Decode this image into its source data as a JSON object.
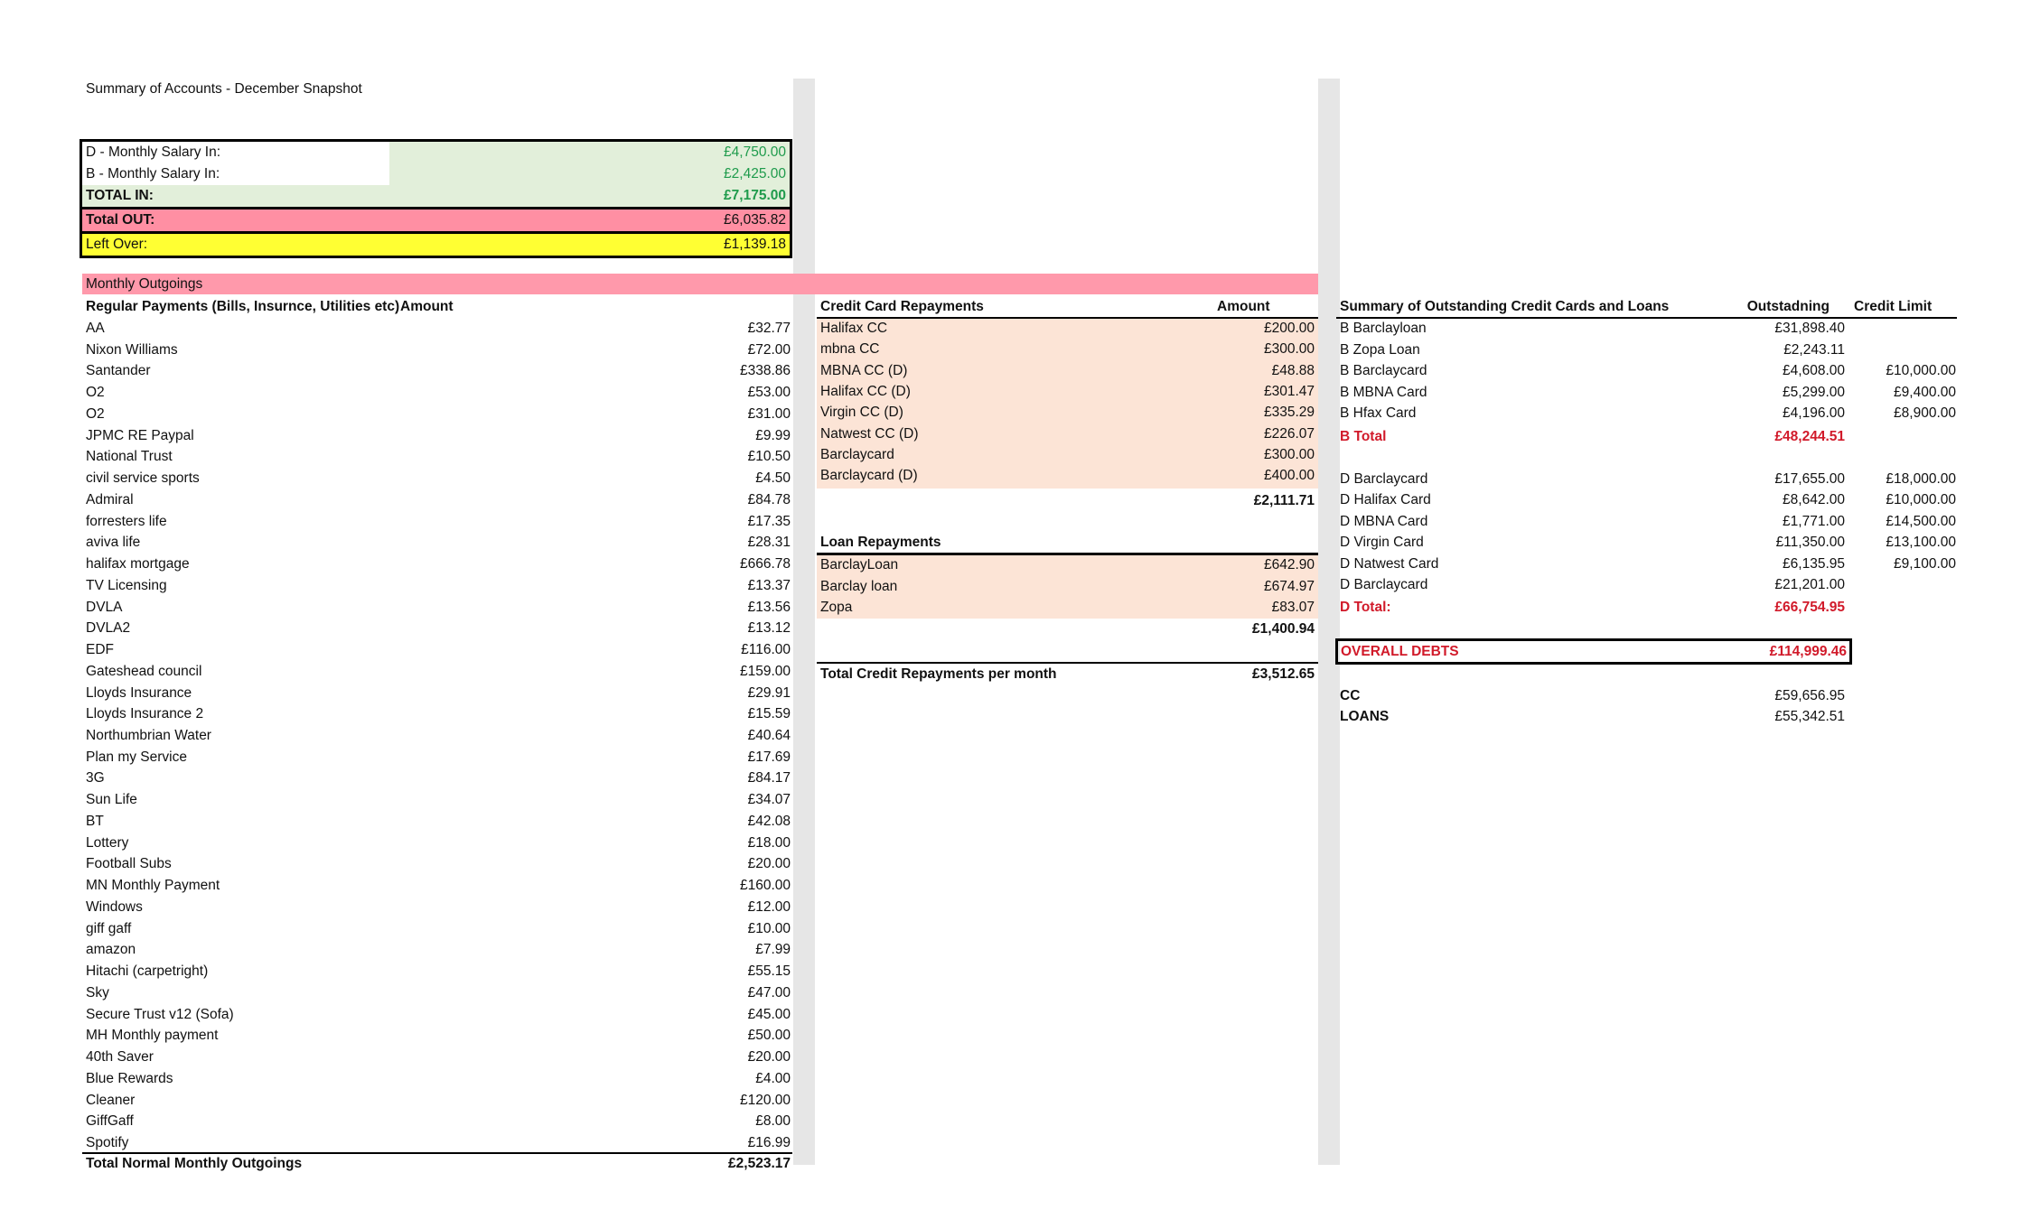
{
  "title": "Summary of Accounts - December Snapshot",
  "income": {
    "d_salary_label": "D - Monthly Salary In:",
    "d_salary_value": "£4,750.00",
    "b_salary_label": "B - Monthly Salary In:",
    "b_salary_value": "£2,425.00",
    "total_in_label": "TOTAL IN:",
    "total_in_value": "£7,175.00",
    "total_out_label": "Total OUT:",
    "total_out_value": "£6,035.82",
    "left_over_label": "Left Over:",
    "left_over_value": "£1,139.18"
  },
  "section_title": "Monthly Outgoings",
  "regular": {
    "header_label": "Regular Payments (Bills, Insurnce, Utilities etc)",
    "header_amount": "Amount",
    "rows": [
      {
        "name": "AA",
        "amount": "£32.77"
      },
      {
        "name": "Nixon Williams",
        "amount": "£72.00"
      },
      {
        "name": "Santander",
        "amount": "£338.86"
      },
      {
        "name": "O2",
        "amount": "£53.00"
      },
      {
        "name": "O2",
        "amount": "£31.00"
      },
      {
        "name": "JPMC RE Paypal",
        "amount": "£9.99"
      },
      {
        "name": "National Trust",
        "amount": "£10.50"
      },
      {
        "name": "civil service sports",
        "amount": "£4.50"
      },
      {
        "name": "Admiral",
        "amount": "£84.78"
      },
      {
        "name": "forresters life",
        "amount": "£17.35"
      },
      {
        "name": "aviva life",
        "amount": "£28.31"
      },
      {
        "name": "halifax mortgage",
        "amount": "£666.78"
      },
      {
        "name": "TV Licensing",
        "amount": "£13.37"
      },
      {
        "name": "DVLA",
        "amount": "£13.56"
      },
      {
        "name": "DVLA2",
        "amount": "£13.12"
      },
      {
        "name": "EDF",
        "amount": "£116.00"
      },
      {
        "name": "Gateshead council",
        "amount": "£159.00"
      },
      {
        "name": "Lloyds Insurance",
        "amount": "£29.91"
      },
      {
        "name": "Lloyds Insurance 2",
        "amount": "£15.59"
      },
      {
        "name": "Northumbrian Water",
        "amount": "£40.64"
      },
      {
        "name": "Plan my Service",
        "amount": "£17.69"
      },
      {
        "name": "3G",
        "amount": "£84.17"
      },
      {
        "name": "Sun Life",
        "amount": "£34.07"
      },
      {
        "name": "BT",
        "amount": "£42.08"
      },
      {
        "name": "Lottery",
        "amount": "£18.00"
      },
      {
        "name": "Football Subs",
        "amount": "£20.00"
      },
      {
        "name": "MN Monthly Payment",
        "amount": "£160.00"
      },
      {
        "name": "Windows",
        "amount": "£12.00"
      },
      {
        "name": "giff gaff",
        "amount": "£10.00"
      },
      {
        "name": "amazon",
        "amount": "£7.99"
      },
      {
        "name": "Hitachi (carpetright)",
        "amount": "£55.15"
      },
      {
        "name": "Sky",
        "amount": "£47.00"
      },
      {
        "name": "Secure Trust v12 (Sofa)",
        "amount": "£45.00"
      },
      {
        "name": "MH Monthly payment",
        "amount": "£50.00"
      },
      {
        "name": "40th Saver",
        "amount": "£20.00"
      },
      {
        "name": "Blue Rewards",
        "amount": "£4.00"
      },
      {
        "name": "Cleaner",
        "amount": "£120.00"
      },
      {
        "name": "GiffGaff",
        "amount": "£8.00"
      },
      {
        "name": "Spotify",
        "amount": "£16.99"
      }
    ],
    "total_label": "Total Normal Monthly Outgoings",
    "total_value": "£2,523.17"
  },
  "credit_cards": {
    "header_label": "Credit Card Repayments",
    "header_amount": "Amount",
    "rows": [
      {
        "name": "Halifax CC",
        "amount": "£200.00"
      },
      {
        "name": "mbna CC",
        "amount": "£300.00"
      },
      {
        "name": "MBNA CC (D)",
        "amount": "£48.88"
      },
      {
        "name": "Halifax CC (D)",
        "amount": "£301.47"
      },
      {
        "name": "Virgin CC (D)",
        "amount": "£335.29"
      },
      {
        "name": "Natwest CC (D)",
        "amount": "£226.07"
      },
      {
        "name": "Barclaycard",
        "amount": "£300.00"
      },
      {
        "name": "Barclaycard (D)",
        "amount": "£400.00"
      }
    ],
    "subtotal": "£2,111.71"
  },
  "loans": {
    "header_label": "Loan Repayments",
    "rows": [
      {
        "name": "BarclayLoan",
        "amount": "£642.90"
      },
      {
        "name": "Barclay loan",
        "amount": "£674.97"
      },
      {
        "name": "Zopa",
        "amount": "£83.07"
      }
    ],
    "subtotal": "£1,400.94",
    "total_label": "Total Credit Repayments per month",
    "total_value": "£3,512.65"
  },
  "outstanding": {
    "header_label": "Summary of Outstanding Credit Cards and Loans",
    "header_outstanding": "Outstadning",
    "header_limit": "Credit Limit",
    "b_rows": [
      {
        "name": "B Barclayloan",
        "outstanding": "£31,898.40",
        "limit": ""
      },
      {
        "name": "B Zopa Loan",
        "outstanding": "£2,243.11",
        "limit": ""
      },
      {
        "name": "B Barclaycard",
        "outstanding": "£4,608.00",
        "limit": "£10,000.00"
      },
      {
        "name": "B MBNA Card",
        "outstanding": "£5,299.00",
        "limit": "£9,400.00"
      },
      {
        "name": "B Hfax Card",
        "outstanding": "£4,196.00",
        "limit": "£8,900.00"
      }
    ],
    "b_total_label": "B Total",
    "b_total_value": "£48,244.51",
    "d_rows": [
      {
        "name": "D Barclaycard",
        "outstanding": "£17,655.00",
        "limit": "£18,000.00"
      },
      {
        "name": "D Halifax Card",
        "outstanding": "£8,642.00",
        "limit": "£10,000.00"
      },
      {
        "name": "D MBNA Card",
        "outstanding": "£1,771.00",
        "limit": "£14,500.00"
      },
      {
        "name": "D Virgin Card",
        "outstanding": "£11,350.00",
        "limit": "£13,100.00"
      },
      {
        "name": "D Natwest Card",
        "outstanding": "£6,135.95",
        "limit": "£9,100.00"
      },
      {
        "name": "D Barclaycard",
        "outstanding": "£21,201.00",
        "limit": ""
      }
    ],
    "d_total_label": "D Total:",
    "d_total_value": "£66,754.95",
    "overall_label": "OVERALL DEBTS",
    "overall_value": "£114,999.46",
    "cc_label": "CC",
    "cc_value": "£59,656.95",
    "loans_label": "LOANS",
    "loans_value": "£55,342.51"
  },
  "colors": {
    "green": "#1f9b4c",
    "red": "#d11a2a",
    "pink_band": "#ff99ab",
    "peach": "#fce4d6",
    "yellow": "#ffff33",
    "light_green": "#e2efda"
  }
}
